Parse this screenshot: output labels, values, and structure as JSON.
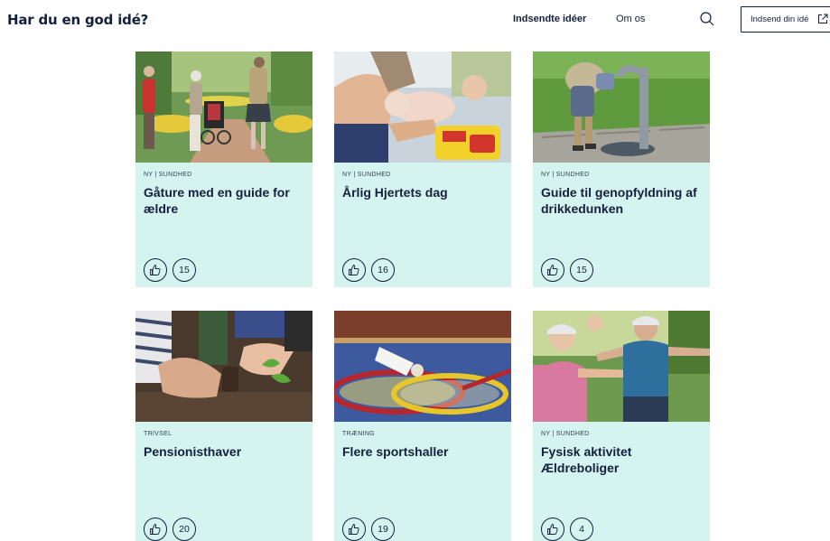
{
  "header": {
    "logo": "Har du en god idé?",
    "nav": {
      "submitted": "Indsendte idéer",
      "about": "Om os"
    },
    "search_icon": "search-icon",
    "submit_button": "Indsend din idé"
  },
  "cards": [
    {
      "category": "NY | SUNDHED",
      "title": "Gåture med en guide for ældre",
      "likes": "15",
      "image": "seniors-walking-in-park-photo"
    },
    {
      "category": "NY | SUNDHED",
      "title": "Årlig Hjertets dag",
      "likes": "16",
      "image": "cpr-defibrillator-training-photo"
    },
    {
      "category": "NY | SUNDHED",
      "title": "Guide til genopfyldning af drikkedunken",
      "likes": "15",
      "image": "water-fountain-photo"
    },
    {
      "category": "TRIVSEL",
      "title": "Pensionisthaver",
      "likes": "20",
      "image": "gardening-hands-photo"
    },
    {
      "category": "TRÆNING",
      "title": "Flere sportshaller",
      "likes": "19",
      "image": "badminton-rackets-photo"
    },
    {
      "category": "NY | SUNDHED",
      "title": "Fysisk aktivitet Ældreboliger",
      "likes": "4",
      "image": "seniors-exercising-outdoors-photo"
    }
  ],
  "colors": {
    "card_bg": "#d5f3ef",
    "text": "#14213d"
  }
}
